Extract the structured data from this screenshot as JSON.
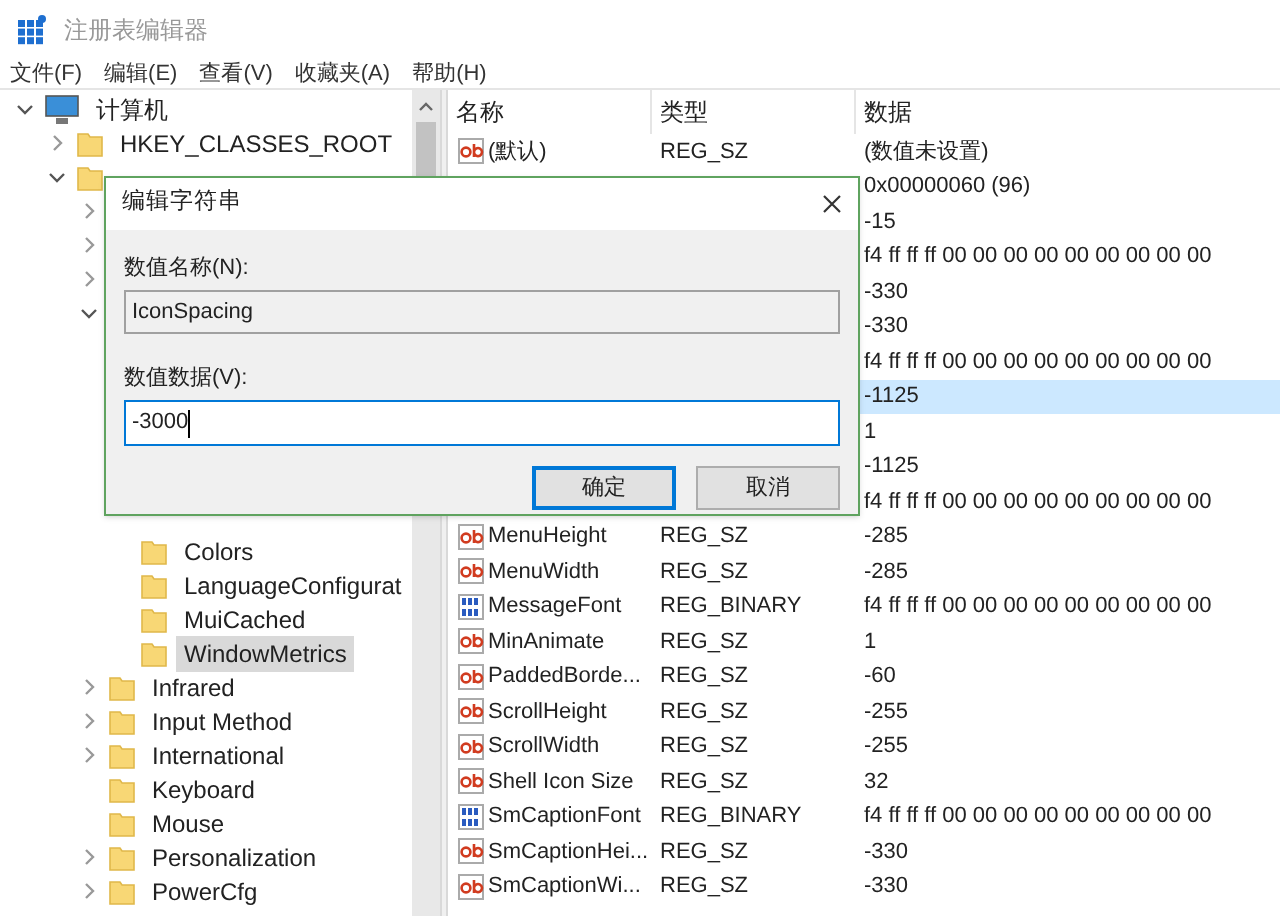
{
  "window": {
    "title": "注册表编辑器"
  },
  "menu": [
    "文件(F)",
    "编辑(E)",
    "查看(V)",
    "收藏夹(A)",
    "帮助(H)"
  ],
  "tree": [
    {
      "label": "计算机",
      "kind": "computer",
      "expanded": true,
      "children": [
        {
          "label": "HKEY_CLASSES_ROOT",
          "expanded": false,
          "selected": false
        },
        {
          "kind": "folder",
          "expanded": true,
          "children": [
            {
              "expanded": false
            },
            {
              "expanded": false
            },
            {
              "expanded": false
            },
            {
              "expanded": true,
              "children": [
                {
                  "label": "Colors",
                  "selected": false
                },
                {
                  "label": "LanguageConfigurat",
                  "selected": false
                },
                {
                  "label": "MuiCached",
                  "selected": false
                },
                {
                  "label": "WindowMetrics",
                  "selected": true
                }
              ]
            },
            {
              "label": "Infrared",
              "expanded": false,
              "selected": false
            },
            {
              "label": "Input Method",
              "expanded": false,
              "selected": false
            },
            {
              "label": "International",
              "expanded": false,
              "selected": false
            },
            {
              "label": "Keyboard",
              "selected": false
            },
            {
              "label": "Mouse",
              "selected": false
            },
            {
              "label": "Personalization",
              "expanded": false,
              "selected": false
            },
            {
              "label": "PowerCfg",
              "expanded": false,
              "selected": false
            }
          ]
        }
      ]
    }
  ],
  "table": {
    "columns": [
      "名称",
      "类型",
      "数据"
    ],
    "rows": [
      {
        "name": "(默认)",
        "type": "REG_SZ",
        "data": "(数值未设置)",
        "kind": "string",
        "selected": false
      },
      {
        "data": "0x00000060 (96)",
        "selected": false
      },
      {
        "data": "-15",
        "selected": false
      },
      {
        "data": "f4 ff ff ff 00 00 00 00 00 00 00 00 00",
        "selected": false
      },
      {
        "data": "-330",
        "selected": false
      },
      {
        "data": "-330",
        "selected": false
      },
      {
        "data": "f4 ff ff ff 00 00 00 00 00 00 00 00 00",
        "selected": false
      },
      {
        "data": "-1125",
        "selected": true
      },
      {
        "data": "1",
        "selected": false
      },
      {
        "data": "-1125",
        "selected": false
      },
      {
        "data": "f4 ff ff ff 00 00 00 00 00 00 00 00 00",
        "selected": false
      },
      {
        "name": "MenuHeight",
        "type": "REG_SZ",
        "data": "-285",
        "kind": "string",
        "selected": false
      },
      {
        "name": "MenuWidth",
        "type": "REG_SZ",
        "data": "-285",
        "kind": "string",
        "selected": false
      },
      {
        "name": "MessageFont",
        "type": "REG_BINARY",
        "data": "f4 ff ff ff 00 00 00 00 00 00 00 00 00",
        "kind": "binary",
        "selected": false
      },
      {
        "name": "MinAnimate",
        "type": "REG_SZ",
        "data": "1",
        "kind": "string",
        "selected": false
      },
      {
        "name": "PaddedBorde...",
        "type": "REG_SZ",
        "data": "-60",
        "kind": "string",
        "selected": false
      },
      {
        "name": "ScrollHeight",
        "type": "REG_SZ",
        "data": "-255",
        "kind": "string",
        "selected": false
      },
      {
        "name": "ScrollWidth",
        "type": "REG_SZ",
        "data": "-255",
        "kind": "string",
        "selected": false
      },
      {
        "name": "Shell Icon Size",
        "type": "REG_SZ",
        "data": "32",
        "kind": "string",
        "selected": false
      },
      {
        "name": "SmCaptionFont",
        "type": "REG_BINARY",
        "data": "f4 ff ff ff 00 00 00 00 00 00 00 00 00",
        "kind": "binary",
        "selected": false
      },
      {
        "name": "SmCaptionHei...",
        "type": "REG_SZ",
        "data": "-330",
        "kind": "string",
        "selected": false
      },
      {
        "name": "SmCaptionWi...",
        "type": "REG_SZ",
        "data": "-330",
        "kind": "string",
        "selected": false
      }
    ]
  },
  "dialog": {
    "title": "编辑字符串",
    "name_label": "数值名称(N):",
    "name_value": "IconSpacing",
    "data_label": "数值数据(V):",
    "data_value": "-3000",
    "buttons": [
      "确定",
      "取消"
    ]
  }
}
